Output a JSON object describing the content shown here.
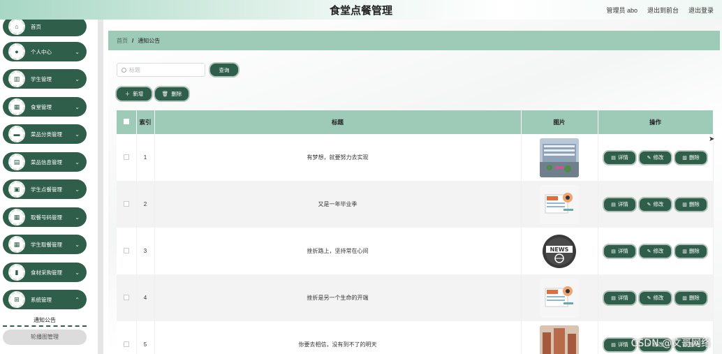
{
  "header": {
    "title": "食堂点餐管理",
    "user_label": "管理员 abo",
    "front_link": "退出到前台",
    "logout_link": "退出登录"
  },
  "sidebar": {
    "items": [
      {
        "label": "首页",
        "icon": "home-icon",
        "has_arrow": false
      },
      {
        "label": "个人中心",
        "icon": "user-icon",
        "has_arrow": true
      },
      {
        "label": "学生管理",
        "icon": "chart-icon",
        "has_arrow": true
      },
      {
        "label": "食堂管理",
        "icon": "grid-icon",
        "has_arrow": true
      },
      {
        "label": "菜品分类管理",
        "icon": "folder-icon",
        "has_arrow": true
      },
      {
        "label": "菜品信息管理",
        "icon": "clipboard-icon",
        "has_arrow": true
      },
      {
        "label": "学生点餐管理",
        "icon": "briefcase-icon",
        "has_arrow": true
      },
      {
        "label": "取餐号码管理",
        "icon": "grid-icon",
        "has_arrow": true
      },
      {
        "label": "学生取餐管理",
        "icon": "grid-icon",
        "has_arrow": true
      },
      {
        "label": "食材采购管理",
        "icon": "bag-icon",
        "has_arrow": true
      },
      {
        "label": "系统管理",
        "icon": "apps-icon",
        "has_arrow": true
      }
    ],
    "sub_items": [
      "通知公告",
      "轮播图管理"
    ]
  },
  "breadcrumb": {
    "home": "首页",
    "separator": "/",
    "current": "通知公告"
  },
  "toolbar": {
    "search_placeholder": "标题",
    "query_label": "查询",
    "add_label": "新增",
    "delete_label": "删除"
  },
  "table": {
    "columns": [
      "索引",
      "标题",
      "图片",
      "操作"
    ],
    "rows": [
      {
        "index": "1",
        "title": "有梦想，就要努力去实现",
        "image": "building-photo"
      },
      {
        "index": "2",
        "title": "又是一年毕业季",
        "image": "news-paper-illustration"
      },
      {
        "index": "3",
        "title": "挫折路上，坚持常在心间",
        "image": "news-globe-badge"
      },
      {
        "index": "4",
        "title": "挫折是另一个生命的开端",
        "image": "news-paper-illustration"
      },
      {
        "index": "5",
        "title": "你要去相信，没有到不了的明天",
        "image": "city-photo"
      }
    ],
    "actions": {
      "detail": "详情",
      "edit": "修改",
      "delete": "删除"
    }
  },
  "watermark": "CSDN @文哥网络",
  "colors": {
    "primary": "#2f5e4a",
    "header_bg": "#9ecbb7",
    "topbar_accent": "#a7d7c5"
  }
}
